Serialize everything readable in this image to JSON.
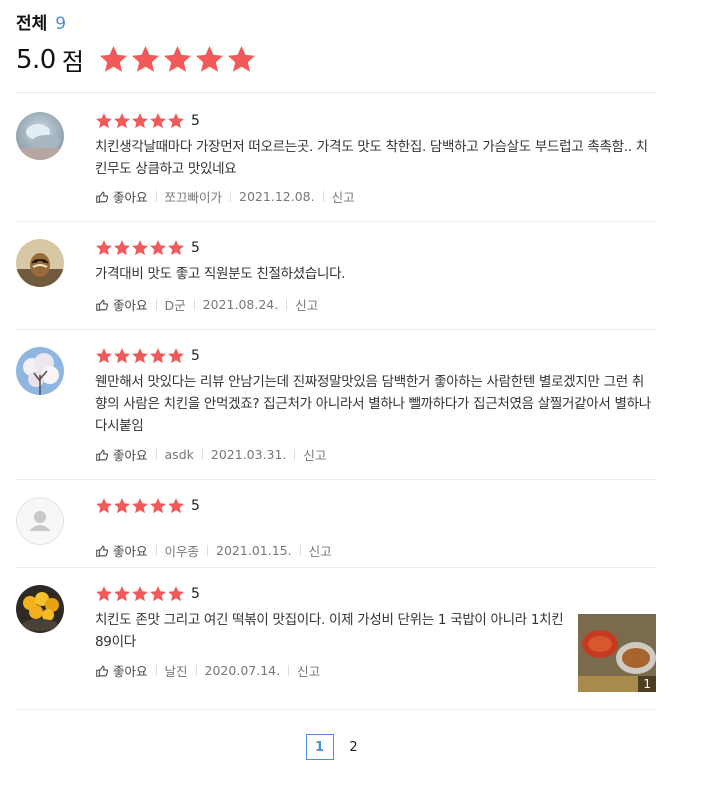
{
  "summary": {
    "total_label": "전체",
    "total_count": "9",
    "score": "5.0",
    "score_unit": "점",
    "star_rating": 5
  },
  "colors": {
    "star": "#f15a5a",
    "accent": "#4a90d9"
  },
  "like_label": "좋아요",
  "report_label": "신고",
  "reviews": [
    {
      "rating": "5",
      "text": "치킨생각날때마다 가장먼저 떠오르는곳. 가격도 맛도 착한집. 담백하고 가슴살도 부드럽고 촉촉함.. 치킨무도 상큼하고 맛있네요",
      "author": "쪼끄빠이가",
      "date": "2021.12.08.",
      "avatar": "cloud-photo"
    },
    {
      "rating": "5",
      "text": "가격대비 맛도 좋고 직원분도 친절하셨습니다.",
      "author": "D군",
      "date": "2021.08.24.",
      "avatar": "chipmunk-photo"
    },
    {
      "rating": "5",
      "text": "웬만해서 맛있다는 리뷰 안남기는데 진짜정말맛있음  담백한거 좋아하는 사람한텐 별로겠지만 그런 취향의 사람은 치킨을 안먹겠죠?  집근처가 아니라서 별하나 뺄까하다가 집근처였음 살찔거같아서 별하나 다시붙임",
      "author": "asdk",
      "date": "2021.03.31.",
      "avatar": "blossom-photo"
    },
    {
      "rating": "5",
      "text": "",
      "author": "이우종",
      "date": "2021.01.15.",
      "avatar": "default-user"
    },
    {
      "rating": "5",
      "text": "치킨도 존맛 그리고 여긴 떡볶이 맛집이다. 이제 가성비 단위는 1 국밥이 아니라 1치킨89이다",
      "author": "날진",
      "date": "2020.07.14.",
      "avatar": "fruit-photo",
      "photo_count": "1"
    }
  ],
  "pagination": {
    "pages": [
      "1",
      "2"
    ],
    "current": "1"
  }
}
